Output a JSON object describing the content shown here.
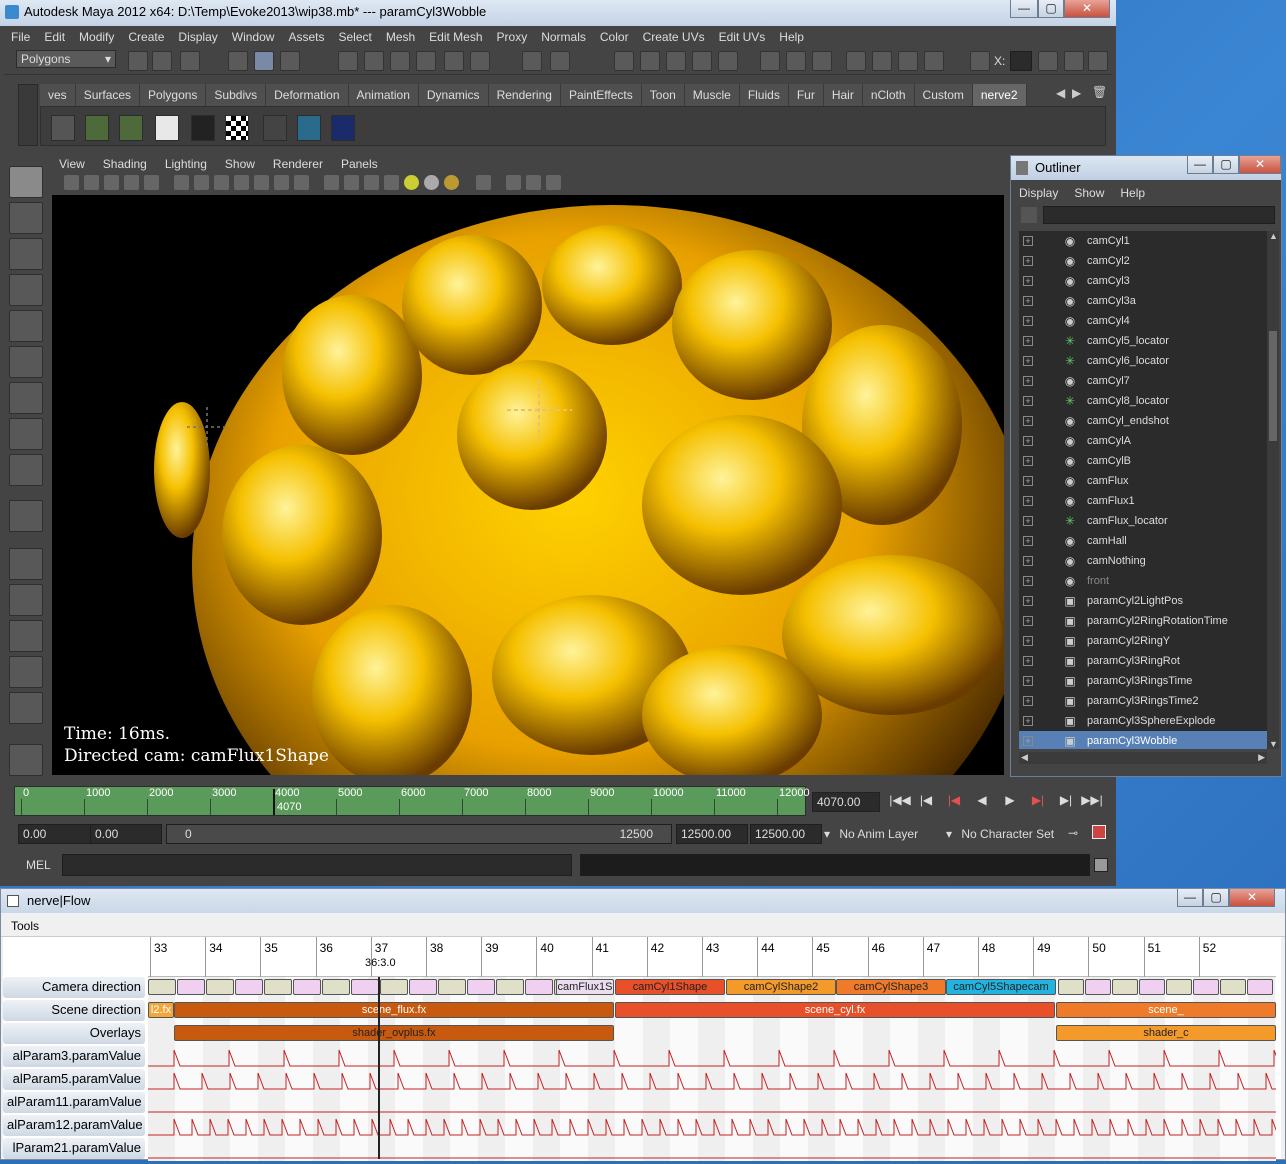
{
  "maya": {
    "title": "Autodesk Maya 2012 x64: D:\\Temp\\Evoke2013\\wip38.mb*   ---   paramCyl3Wobble",
    "win_min": "—",
    "win_max": "▢",
    "win_close": "✕",
    "menus": [
      "File",
      "Edit",
      "Modify",
      "Create",
      "Display",
      "Window",
      "Assets",
      "Select",
      "Mesh",
      "Edit Mesh",
      "Proxy",
      "Normals",
      "Color",
      "Create UVs",
      "Edit UVs",
      "Help"
    ],
    "mode_menu": "Polygons",
    "coord_label": "X:",
    "shelf_tabs": [
      "ves",
      "Surfaces",
      "Polygons",
      "Subdivs",
      "Deformation",
      "Animation",
      "Dynamics",
      "Rendering",
      "PaintEffects",
      "Toon",
      "Muscle",
      "Fluids",
      "Fur",
      "Hair",
      "nCloth",
      "Custom",
      "nerve2"
    ],
    "shelf_selected": "nerve2",
    "panel_menus": [
      "View",
      "Shading",
      "Lighting",
      "Show",
      "Renderer",
      "Panels"
    ],
    "hud_time": "Time: 16ms.",
    "hud_cam": "Directed cam: camFlux1Shape",
    "time_ticks": [
      "0",
      "1000",
      "2000",
      "3000",
      "4000",
      "5000",
      "6000",
      "7000",
      "8000",
      "9000",
      "10000",
      "11000",
      "12000"
    ],
    "time_marker": "4070",
    "current_time": "4070.00",
    "range_start": "0.00",
    "range_start2": "0.00",
    "range_slider_left": "0",
    "range_slider_right": "12500",
    "range_end": "12500.00",
    "range_end2": "12500.00",
    "anim_layer": "No Anim Layer",
    "char_set": "No Character Set",
    "mel_label": "MEL"
  },
  "outliner": {
    "title": "Outliner",
    "menus": [
      "Display",
      "Show",
      "Help"
    ],
    "items": [
      {
        "label": "camCyl1",
        "icon": "camera-icon"
      },
      {
        "label": "camCyl2",
        "icon": "camera-icon"
      },
      {
        "label": "camCyl3",
        "icon": "camera-icon"
      },
      {
        "label": "camCyl3a",
        "icon": "camera-icon"
      },
      {
        "label": "camCyl4",
        "icon": "camera-icon"
      },
      {
        "label": "camCyl5_locator",
        "icon": "locator-icon"
      },
      {
        "label": "camCyl6_locator",
        "icon": "locator-icon"
      },
      {
        "label": "camCyl7",
        "icon": "camera-icon"
      },
      {
        "label": "camCyl8_locator",
        "icon": "locator-icon"
      },
      {
        "label": "camCyl_endshot",
        "icon": "camera-icon"
      },
      {
        "label": "camCylA",
        "icon": "camera-icon"
      },
      {
        "label": "camCylB",
        "icon": "camera-icon"
      },
      {
        "label": "camFlux",
        "icon": "camera-icon"
      },
      {
        "label": "camFlux1",
        "icon": "camera-icon"
      },
      {
        "label": "camFlux_locator",
        "icon": "locator-icon"
      },
      {
        "label": "camHall",
        "icon": "camera-icon"
      },
      {
        "label": "camNothing",
        "icon": "camera-icon"
      },
      {
        "label": "front",
        "icon": "camera-icon",
        "dim": true
      },
      {
        "label": "paramCyl2LightPos",
        "icon": "cube-icon"
      },
      {
        "label": "paramCyl2RingRotationTime",
        "icon": "cube-icon"
      },
      {
        "label": "paramCyl2RingY",
        "icon": "cube-icon"
      },
      {
        "label": "paramCyl3RingRot",
        "icon": "cube-icon"
      },
      {
        "label": "paramCyl3RingsTime",
        "icon": "cube-icon"
      },
      {
        "label": "paramCyl3RingsTime2",
        "icon": "cube-icon"
      },
      {
        "label": "paramCyl3SphereExplode",
        "icon": "cube-icon"
      },
      {
        "label": "paramCyl3Wobble",
        "icon": "cube-icon",
        "selected": true
      }
    ]
  },
  "flow": {
    "title": "nerve|Flow",
    "tools_menu": "Tools",
    "ruler": [
      "33",
      "34",
      "35",
      "36",
      "37",
      "38",
      "39",
      "40",
      "41",
      "42",
      "43",
      "44",
      "45",
      "46",
      "47",
      "48",
      "49",
      "50",
      "51",
      "52"
    ],
    "playhead_label": "36:3.0",
    "tracks": [
      {
        "label": "Camera direction"
      },
      {
        "label": "Scene direction"
      },
      {
        "label": "Overlays"
      },
      {
        "label": "alParam3.paramValue"
      },
      {
        "label": "alParam5.paramValue"
      },
      {
        "label": "alParam11.paramValue"
      },
      {
        "label": "alParam12.paramValue"
      },
      {
        "label": "lParam21.paramValue"
      }
    ],
    "camera_clips": [
      {
        "label": "camCyl1Shape",
        "color": "#e8502a"
      },
      {
        "label": "camCylShape2",
        "color": "#f39a2a"
      },
      {
        "label": "camCylShape3",
        "color": "#ef7a2a"
      },
      {
        "label": "camCyl5Shapecam",
        "color": "#22b4e0"
      }
    ],
    "scene_clips": [
      {
        "label": "l2.fx",
        "color": "#f3a63a"
      },
      {
        "label": "scene_flux.fx",
        "color": "#c85a10"
      },
      {
        "label": "scene_cyl.fx",
        "color": "#e8502a"
      },
      {
        "label": "scene_",
        "color": "#ef7a2a"
      }
    ],
    "overlay_clips": [
      {
        "label": "shader_ovplus.fx",
        "color": "#c85a10"
      },
      {
        "label": "shader_c",
        "color": "#f39a2a"
      }
    ],
    "small_clip_label": "camFlux1S"
  }
}
